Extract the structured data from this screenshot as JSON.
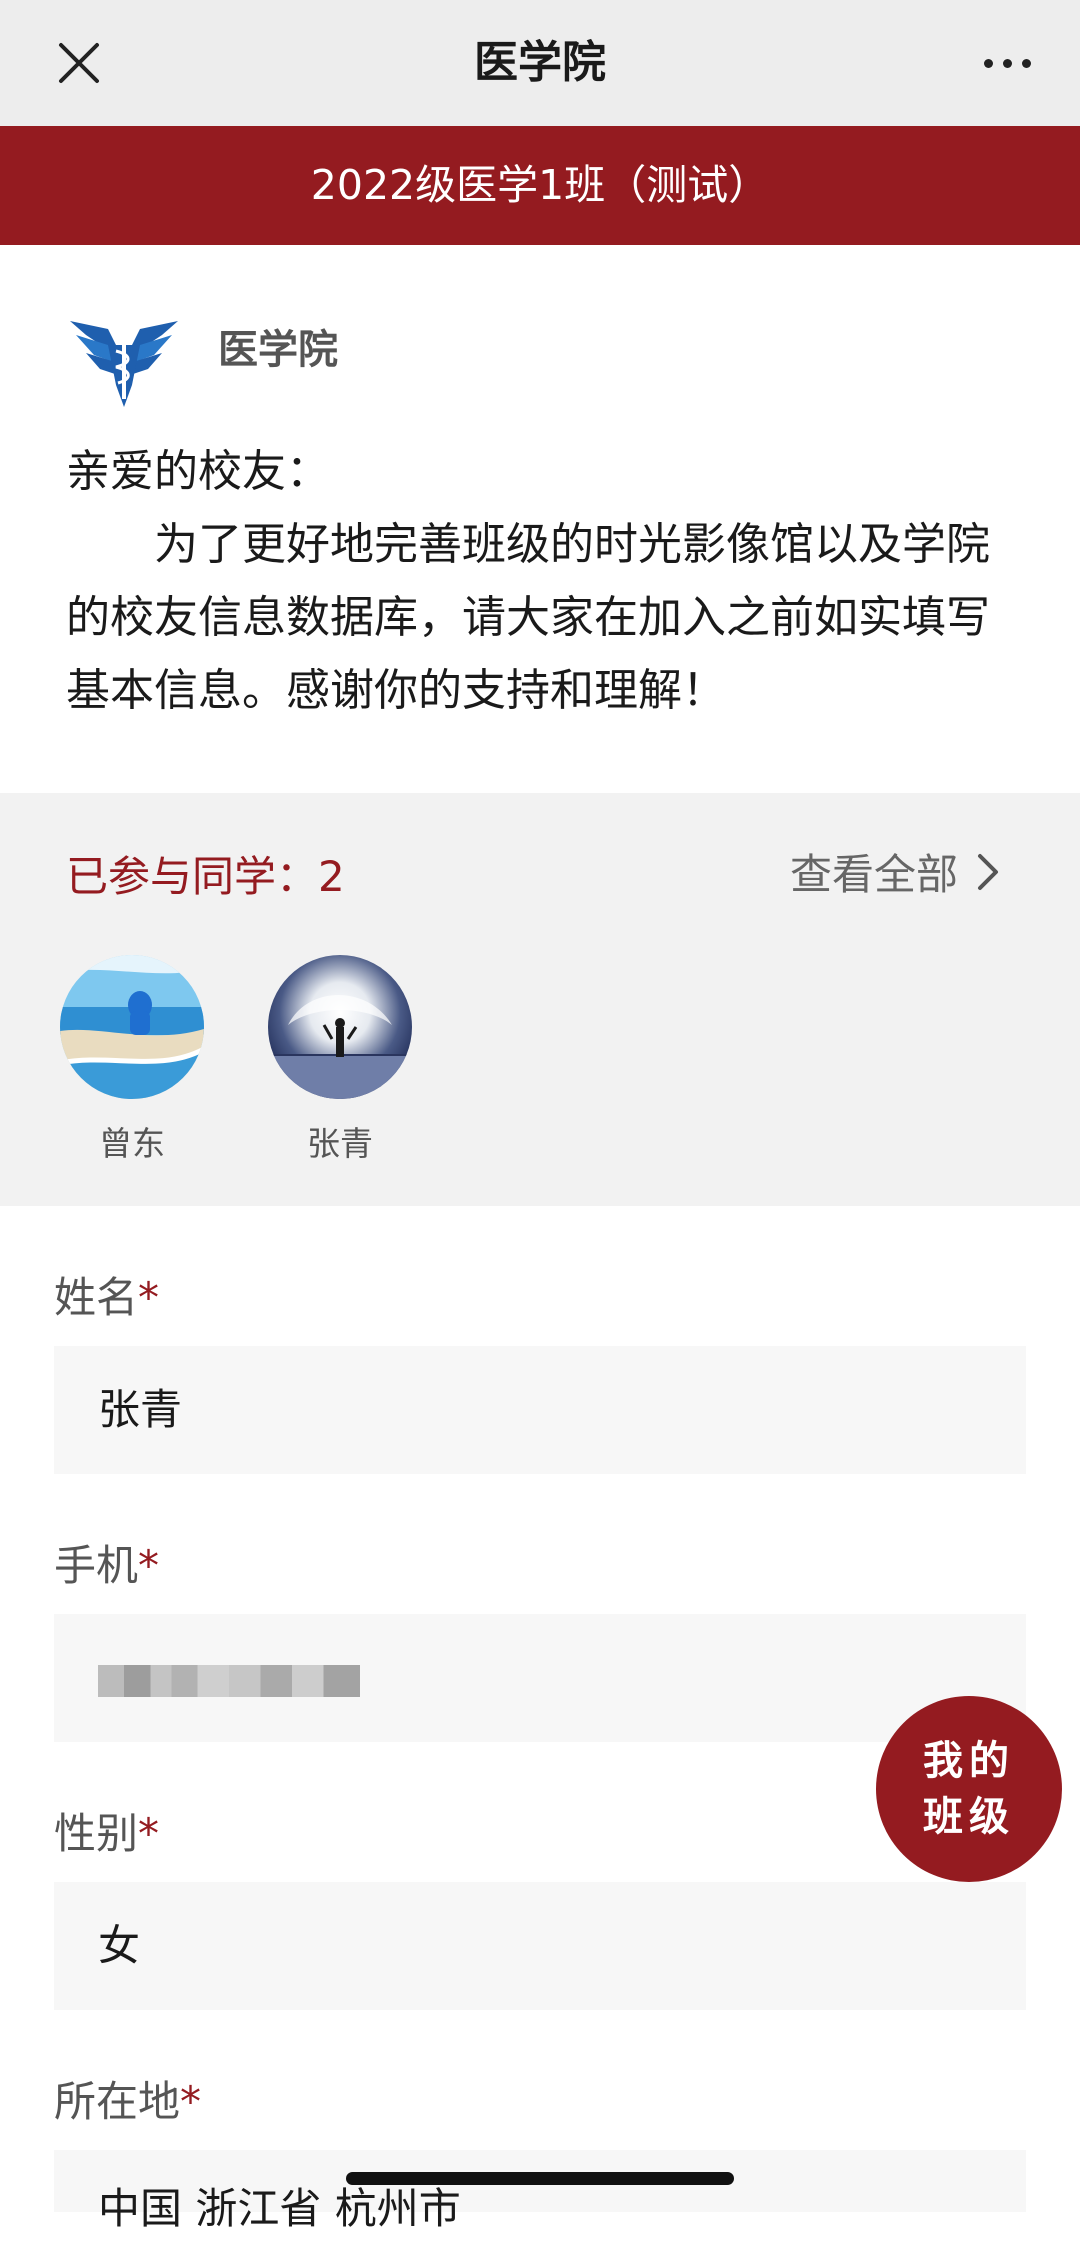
{
  "navbar": {
    "title": "医学院"
  },
  "banner": {
    "text": "2022级医学1班（测试）"
  },
  "intro": {
    "org_name": "医学院",
    "greeting": "亲爱的校友：",
    "body": "为了更好地完善班级的时光影像馆以及学院的校友信息数据库，请大家在加入之前如实填写基本信息。感谢你的支持和理解！"
  },
  "participants": {
    "label": "已参与同学：",
    "count": "2",
    "view_all": "查看全部",
    "members": [
      {
        "name": "曾东"
      },
      {
        "name": "张青"
      }
    ]
  },
  "form": {
    "required_mark": "*",
    "fields": [
      {
        "label": "姓名",
        "value": "张青"
      },
      {
        "label": "手机",
        "value": ""
      },
      {
        "label": "性别",
        "value": "女"
      },
      {
        "label": "所在地",
        "value": "中国 浙江省 杭州市"
      }
    ]
  },
  "fab": {
    "line1": "我的",
    "line2": "班级"
  },
  "colors": {
    "brand": "#941b20",
    "navbar_bg": "#ededed",
    "section_bg": "#f2f2f2",
    "input_bg": "#f7f7f7"
  }
}
